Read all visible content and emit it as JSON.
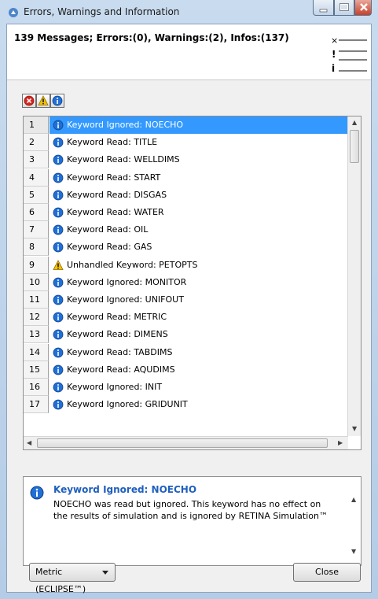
{
  "window": {
    "title": "Errors, Warnings and Information"
  },
  "summary": "139 Messages; Errors:(0), Warnings:(2), Infos:(137)",
  "filters": [
    {
      "name": "error-filter",
      "icon": "error-icon"
    },
    {
      "name": "warning-filter",
      "icon": "warning-icon"
    },
    {
      "name": "info-filter",
      "icon": "info-icon"
    }
  ],
  "messages": [
    {
      "num": "1",
      "type": "info",
      "text": "Keyword Ignored: NOECHO",
      "selected": true
    },
    {
      "num": "2",
      "type": "info",
      "text": "Keyword Read: TITLE"
    },
    {
      "num": "3",
      "type": "info",
      "text": "Keyword Read: WELLDIMS"
    },
    {
      "num": "4",
      "type": "info",
      "text": "Keyword Read: START"
    },
    {
      "num": "5",
      "type": "info",
      "text": "Keyword Read: DISGAS"
    },
    {
      "num": "6",
      "type": "info",
      "text": "Keyword Read: WATER"
    },
    {
      "num": "7",
      "type": "info",
      "text": "Keyword Read: OIL"
    },
    {
      "num": "8",
      "type": "info",
      "text": "Keyword Read: GAS"
    },
    {
      "num": "9",
      "type": "warning",
      "text": "Unhandled Keyword: PETOPTS"
    },
    {
      "num": "10",
      "type": "info",
      "text": "Keyword Ignored: MONITOR"
    },
    {
      "num": "11",
      "type": "info",
      "text": "Keyword Ignored: UNIFOUT"
    },
    {
      "num": "12",
      "type": "info",
      "text": "Keyword Read: METRIC"
    },
    {
      "num": "13",
      "type": "info",
      "text": "Keyword Read: DIMENS"
    },
    {
      "num": "14",
      "type": "info",
      "text": "Keyword Read: TABDIMS"
    },
    {
      "num": "15",
      "type": "info",
      "text": "Keyword Read: AQUDIMS"
    },
    {
      "num": "16",
      "type": "info",
      "text": "Keyword Ignored: INIT"
    },
    {
      "num": "17",
      "type": "info",
      "text": "Keyword Ignored: GRIDUNIT"
    }
  ],
  "detail": {
    "title": "Keyword Ignored: NOECHO",
    "body": "NOECHO was read but ignored. This keyword has no effect on the results of simulation and is ignored by RETINA Simulation™"
  },
  "units_select": {
    "value": "Metric (ECLIPSE™)"
  },
  "close_label": "Close",
  "colors": {
    "selection": "#3399ff",
    "info": "#1f6fd6",
    "warning": "#f2c200",
    "error": "#d7261e"
  }
}
